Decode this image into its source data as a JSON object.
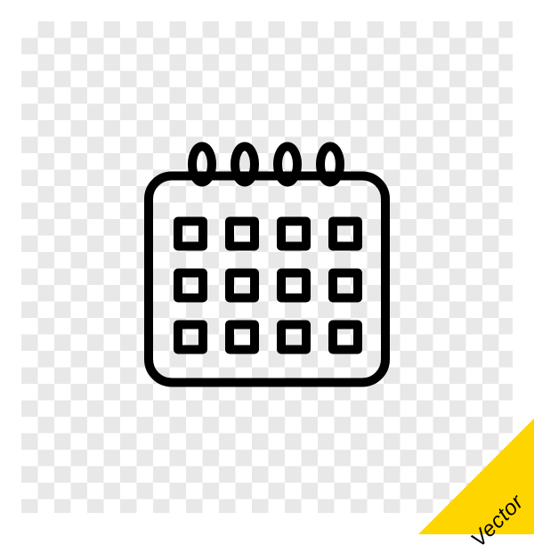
{
  "badge": {
    "label": "Vector"
  },
  "icon": {
    "name": "calendar"
  }
}
